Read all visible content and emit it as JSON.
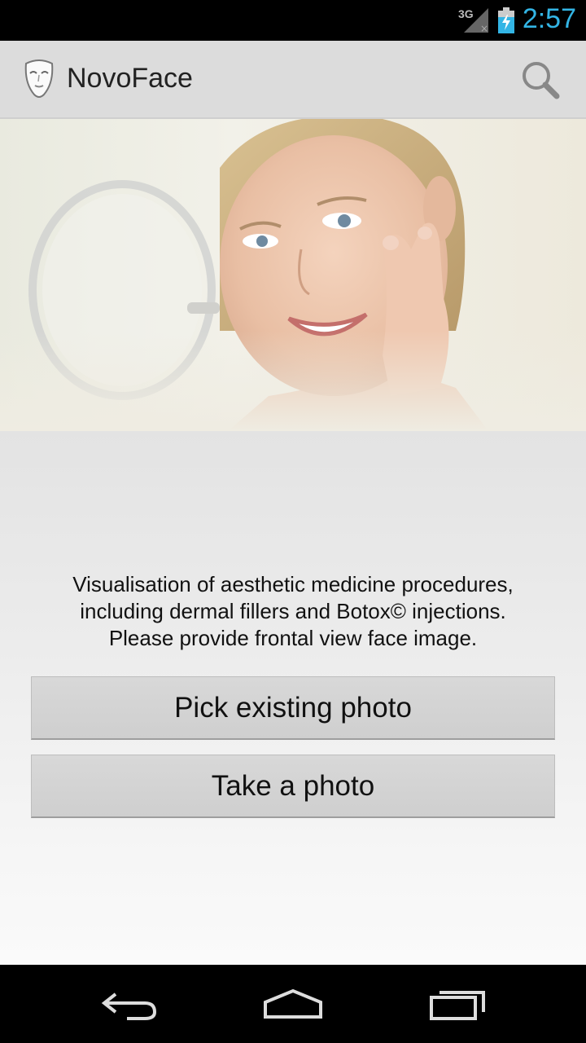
{
  "status_bar": {
    "network": "3G",
    "time": "2:57"
  },
  "action_bar": {
    "title": "NovoFace",
    "icons": {
      "app": "mask-icon",
      "search": "search-icon"
    }
  },
  "main": {
    "description_lines": [
      "Visualisation of aesthetic medicine procedures,",
      "including dermal fillers and Botox© injections.",
      "Please provide frontal view face image."
    ],
    "pick_button_label": "Pick existing photo",
    "take_button_label": "Take a photo"
  },
  "nav_bar": {
    "icons": [
      "back-icon",
      "home-icon",
      "recent-apps-icon"
    ]
  },
  "colors": {
    "accent": "#33b5e5",
    "action_bar_bg": "#dcdcdc",
    "button_bg": "#d3d3d3"
  }
}
